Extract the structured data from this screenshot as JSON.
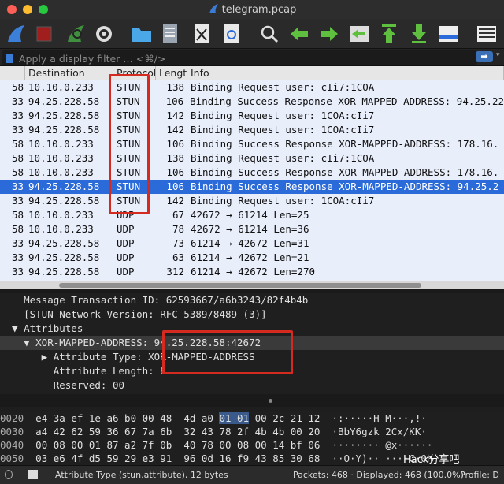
{
  "window": {
    "title": "telegram.pcap"
  },
  "filter": {
    "placeholder": "Apply a display filter … <⌘/>"
  },
  "columns": [
    "",
    "Destination",
    "Protocol",
    "Length",
    "Info"
  ],
  "packets": [
    {
      "no": "58",
      "dst": "10.10.0.233",
      "proto": "STUN",
      "len": "138",
      "info": "Binding Request user: cIi7:1COA"
    },
    {
      "no": "33",
      "dst": "94.25.228.58",
      "proto": "STUN",
      "len": "106",
      "info": "Binding Success Response XOR-MAPPED-ADDRESS: 94.25.22"
    },
    {
      "no": "33",
      "dst": "94.25.228.58",
      "proto": "STUN",
      "len": "142",
      "info": "Binding Request user: 1COA:cIi7"
    },
    {
      "no": "33",
      "dst": "94.25.228.58",
      "proto": "STUN",
      "len": "142",
      "info": "Binding Request user: 1COA:cIi7"
    },
    {
      "no": "58",
      "dst": "10.10.0.233",
      "proto": "STUN",
      "len": "106",
      "info": "Binding Success Response XOR-MAPPED-ADDRESS: 178.16."
    },
    {
      "no": "58",
      "dst": "10.10.0.233",
      "proto": "STUN",
      "len": "138",
      "info": "Binding Request user: cIi7:1COA"
    },
    {
      "no": "58",
      "dst": "10.10.0.233",
      "proto": "STUN",
      "len": "106",
      "info": "Binding Success Response XOR-MAPPED-ADDRESS: 178.16."
    },
    {
      "no": "33",
      "dst": "94.25.228.58",
      "proto": "STUN",
      "len": "106",
      "info": "Binding Success Response XOR-MAPPED-ADDRESS: 94.25.2",
      "selected": true
    },
    {
      "no": "33",
      "dst": "94.25.228.58",
      "proto": "STUN",
      "len": "142",
      "info": "Binding Request user: 1COA:cIi7"
    },
    {
      "no": "58",
      "dst": "10.10.0.233",
      "proto": "UDP",
      "len": "67",
      "info": "42672 → 61214 Len=25"
    },
    {
      "no": "58",
      "dst": "10.10.0.233",
      "proto": "UDP",
      "len": "78",
      "info": "42672 → 61214 Len=36"
    },
    {
      "no": "33",
      "dst": "94.25.228.58",
      "proto": "UDP",
      "len": "73",
      "info": "61214 → 42672 Len=31"
    },
    {
      "no": "33",
      "dst": "94.25.228.58",
      "proto": "UDP",
      "len": "63",
      "info": "61214 → 42672 Len=21"
    },
    {
      "no": "33",
      "dst": "94.25.228.58",
      "proto": "UDP",
      "len": "312",
      "info": "61214 → 42672 Len=270"
    }
  ],
  "details": [
    {
      "text": "    Message Transaction ID: 62593667/a6b3243/82f4b4b"
    },
    {
      "text": "    [STUN Network Version: RFC-5389/8489 (3)]"
    },
    {
      "text": "  ▼ Attributes"
    },
    {
      "text": "    ▼ XOR-MAPPED-ADDRESS: 94.25.228.58:42672",
      "selected": true
    },
    {
      "text": "       ▶ Attribute Type: XOR-MAPPED-ADDRESS"
    },
    {
      "text": "         Attribute Length: 8"
    },
    {
      "text": "         Reserved: 00"
    }
  ],
  "hex": [
    {
      "off": "0020",
      "pre": "e4 3a ef 1e a6 b0 00 48  4d a0 ",
      "hi": "01 01",
      "post": " 00 2c 21 12",
      "ascii": "  ·:·····H M···,!·"
    },
    {
      "off": "0030",
      "pre": "a4 42 62 59 36 67 7a 6b  32 43 78 2f 4b 4b 00 20",
      "hi": "",
      "post": "",
      "ascii": "  ·BbY6gzk 2Cx/KK·"
    },
    {
      "off": "0040",
      "pre": "00 08 00 01 87 a2 7f 0b  40 78 00 08 00 14 bf 06",
      "hi": "",
      "post": "",
      "ascii": "  ········ @x······"
    },
    {
      "off": "0050",
      "pre": "03 e6 4f d5 59 29 e3 91  96 0d 16 f9 43 85 30 68",
      "hi": "",
      "post": "",
      "ascii": "  ··O·Y)·· ····C·0h"
    }
  ],
  "status": {
    "field": "Attribute Type (stun.attribute), 12 bytes",
    "packets": "Packets: 468 · Displayed: 468 (100.0%)",
    "profile": "Profile: D"
  },
  "watermark": "Hack分享吧"
}
